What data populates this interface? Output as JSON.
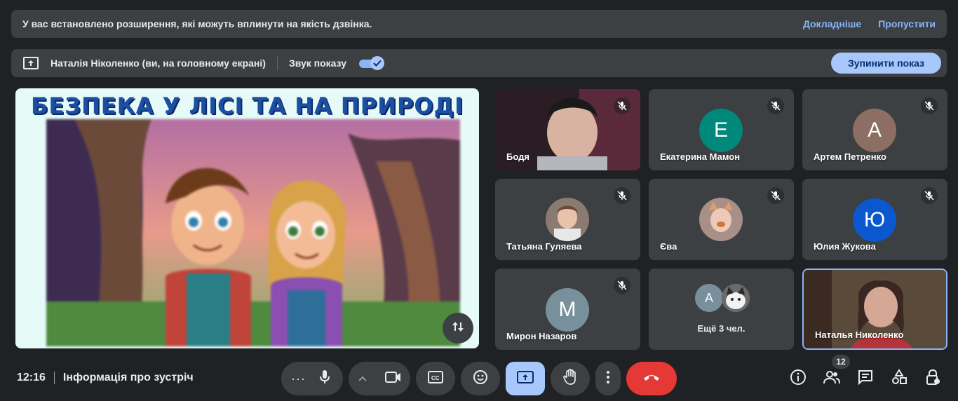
{
  "banner": {
    "message": "У вас встановлено розширення, які можуть вплинути на якість дзвінка.",
    "learn_more": "Докладніше",
    "skip": "Пропустити"
  },
  "presenting": {
    "presenter": "Наталія Ніколенко (ви, на головному екрані)",
    "sound_label": "Звук показу",
    "sound_on": true,
    "stop_button": "Зупинити показ"
  },
  "slide": {
    "title": "БЕЗПЕКА У ЛІСІ ТА НА ПРИРОДІ"
  },
  "participants": [
    {
      "name": "Бодя",
      "type": "video",
      "muted": true
    },
    {
      "name": "Екатерина Мамон",
      "initial": "E",
      "color": "#00897b",
      "muted": true
    },
    {
      "name": "Артем Петренко",
      "initial": "A",
      "color": "#8d6e63",
      "muted": true
    },
    {
      "name": "Татьяна Гуляева",
      "type": "photo",
      "muted": true
    },
    {
      "name": "Єва",
      "type": "photo",
      "muted": true
    },
    {
      "name": "Юлия Жукова",
      "initial": "Ю",
      "color": "#0b57d0",
      "muted": true
    },
    {
      "name": "Мирон Назаров",
      "initial": "М",
      "color": "#78909c",
      "muted": true
    },
    {
      "more_label": "Ещё 3 чел.",
      "initial": "A"
    },
    {
      "name": "Наталья Николенко",
      "type": "video",
      "active": true
    }
  ],
  "toolbar": {
    "time": "12:16",
    "meeting_info": "Інформація про зустріч",
    "people_count": "12"
  },
  "colors": {
    "accent": "#a8c7fa",
    "end_call": "#e53935",
    "tile_bg": "#3c4043"
  }
}
